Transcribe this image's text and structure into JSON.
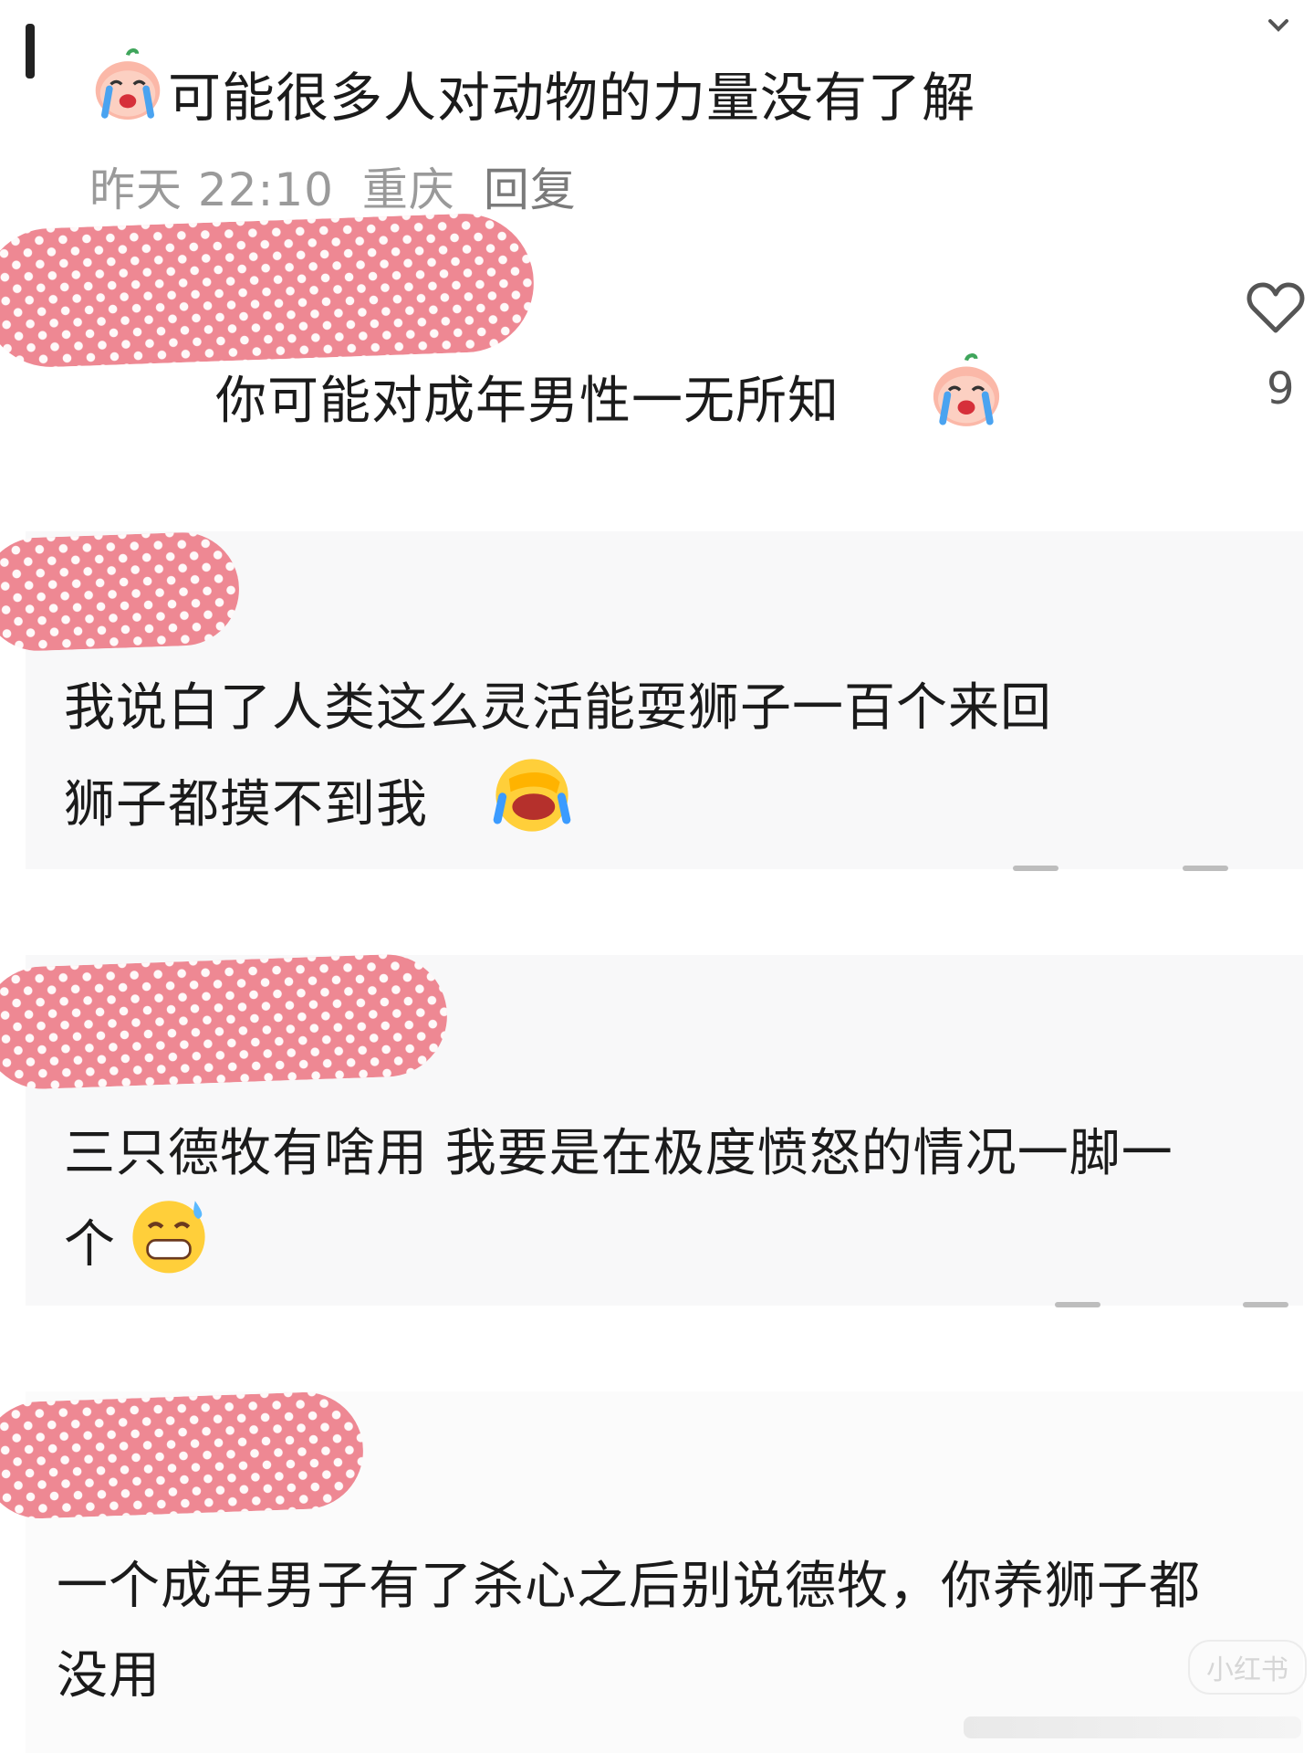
{
  "post": {
    "title": "可能很多人对动物的力量没有了解",
    "meta_time": "昨天 22:10",
    "meta_location": "重庆",
    "meta_reply": "回复"
  },
  "comments": [
    {
      "text": "你可能对成年男性一无所知",
      "likes": "9"
    },
    {
      "line1": "我说白了人类这么灵活能耍狮子一百个来回",
      "line2": "狮子都摸不到我"
    },
    {
      "line1": "三只德牧有啥用 我要是在极度愤怒的情况一脚一",
      "line2": "个"
    },
    {
      "line1": "一个成年男子有了杀心之后别说德牧，你养狮子都",
      "line2": "没用"
    }
  ],
  "watermark": "小红书",
  "icons": {
    "heart": "heart-outline-icon",
    "crying_emoji": "crying-face-emoji",
    "laughing_emoji": "rolling-laughing-emoji",
    "sweat_emoji": "grinning-sweat-emoji"
  },
  "colors": {
    "censor_pink": "#ee8893",
    "meta_gray": "#9a9a9a",
    "text": "#1b1b1b"
  }
}
